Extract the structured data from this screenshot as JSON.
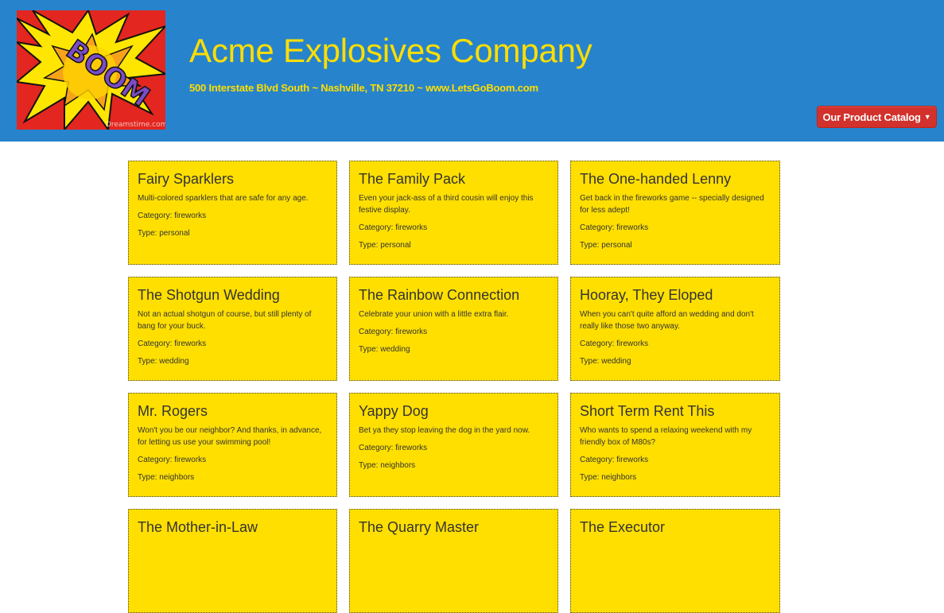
{
  "header": {
    "title": "Acme Explosives Company",
    "subtitle": "500 Interstate Blvd South ~ Nashville, TN 37210 ~ www.LetsGoBoom.com",
    "logo_text": "BOOM",
    "logo_watermark": "Dreamstime.com",
    "catalog_button": "Our Product Catalog"
  },
  "colors": {
    "header_bg": "#2784cc",
    "title_yellow": "#ffde00",
    "card_bg": "#ffdf00",
    "button_red": "#d2312c"
  },
  "icons": {
    "dropdown": "caret-down-icon"
  },
  "labels": {
    "category": "Category:",
    "type": "Type:"
  },
  "products": [
    {
      "name": "Fairy Sparklers",
      "description": "Multi-colored sparklers that are safe for any age.",
      "category": "fireworks",
      "type": "personal"
    },
    {
      "name": "The Family Pack",
      "description": "Even your jack-ass of a third cousin will enjoy this festive display.",
      "category": "fireworks",
      "type": "personal"
    },
    {
      "name": "The One-handed Lenny",
      "description": "Get back in the fireworks game -- specially designed for less adept!",
      "category": "fireworks",
      "type": "personal"
    },
    {
      "name": "The Shotgun Wedding",
      "description": "Not an actual shotgun of course, but still plenty of bang for your buck.",
      "category": "fireworks",
      "type": "wedding"
    },
    {
      "name": "The Rainbow Connection",
      "description": "Celebrate your union with a little extra flair.",
      "category": "fireworks",
      "type": "wedding"
    },
    {
      "name": "Hooray, They Eloped",
      "description": "When you can't quite afford an wedding and don't really like those two anyway.",
      "category": "fireworks",
      "type": "wedding"
    },
    {
      "name": "Mr. Rogers",
      "description": "Won't you be our neighbor? And thanks, in advance, for letting us use your swimming pool!",
      "category": "fireworks",
      "type": "neighbors"
    },
    {
      "name": "Yappy Dog",
      "description": "Bet ya they stop leaving the dog in the yard now.",
      "category": "fireworks",
      "type": "neighbors"
    },
    {
      "name": "Short Term Rent This",
      "description": "Who wants to spend a relaxing weekend with my friendly box of M80s?",
      "category": "fireworks",
      "type": "neighbors"
    },
    {
      "name": "The Mother-in-Law",
      "description": "",
      "category": "",
      "type": ""
    },
    {
      "name": "The Quarry Master",
      "description": "",
      "category": "",
      "type": ""
    },
    {
      "name": "The Executor",
      "description": "",
      "category": "",
      "type": ""
    }
  ]
}
